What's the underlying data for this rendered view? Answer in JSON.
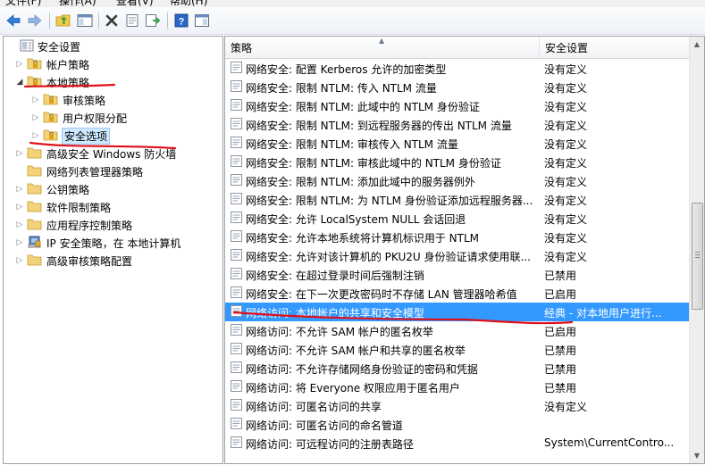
{
  "menu": {
    "items": [
      "文件(F)",
      "操作(A)",
      "查看(V)",
      "帮助(H)"
    ]
  },
  "toolbar": {
    "buttons": [
      "back-icon",
      "forward-icon",
      "up-folder-icon",
      "show-hide-tree-icon",
      "delete-icon",
      "properties-icon",
      "export-list-icon",
      "help-icon",
      "console-icon"
    ]
  },
  "tree": {
    "items": [
      {
        "label": "安全设置",
        "level": 0,
        "expanded": true
      },
      {
        "label": "帐户策略",
        "level": 1,
        "expanded": false
      },
      {
        "label": "本地策略",
        "level": 1,
        "expanded": true
      },
      {
        "label": "审核策略",
        "level": 2,
        "expanded": false
      },
      {
        "label": "用户权限分配",
        "level": 2,
        "expanded": false
      },
      {
        "label": "安全选项",
        "level": 2,
        "expanded": false,
        "selected": true
      },
      {
        "label": "高级安全 Windows 防火墙",
        "level": 1,
        "expanded": false
      },
      {
        "label": "网络列表管理器策略",
        "level": 1,
        "expanded": false
      },
      {
        "label": "公钥策略",
        "level": 1,
        "expanded": false
      },
      {
        "label": "软件限制策略",
        "level": 1,
        "expanded": false
      },
      {
        "label": "应用程序控制策略",
        "level": 1,
        "expanded": false
      },
      {
        "label": "IP 安全策略，在 本地计算机",
        "level": 1,
        "expanded": false
      },
      {
        "label": "高级审核策略配置",
        "level": 1,
        "expanded": false
      }
    ]
  },
  "list": {
    "col_policy": "策略",
    "col_setting": "安全设置",
    "rows": [
      {
        "name": "网络安全: 配置 Kerberos 允许的加密类型",
        "value": "没有定义"
      },
      {
        "name": "网络安全: 限制 NTLM: 传入 NTLM 流量",
        "value": "没有定义"
      },
      {
        "name": "网络安全: 限制 NTLM: 此域中的 NTLM 身份验证",
        "value": "没有定义"
      },
      {
        "name": "网络安全: 限制 NTLM: 到远程服务器的传出 NTLM 流量",
        "value": "没有定义"
      },
      {
        "name": "网络安全: 限制 NTLM: 审核传入 NTLM 流量",
        "value": "没有定义"
      },
      {
        "name": "网络安全: 限制 NTLM: 审核此域中的 NTLM 身份验证",
        "value": "没有定义"
      },
      {
        "name": "网络安全: 限制 NTLM: 添加此域中的服务器例外",
        "value": "没有定义"
      },
      {
        "name": "网络安全: 限制 NTLM: 为 NTLM 身份验证添加远程服务器...",
        "value": "没有定义"
      },
      {
        "name": "网络安全: 允许 LocalSystem NULL 会话回退",
        "value": "没有定义"
      },
      {
        "name": "网络安全: 允许本地系统将计算机标识用于 NTLM",
        "value": "没有定义"
      },
      {
        "name": "网络安全: 允许对该计算机的 PKU2U 身份验证请求使用联...",
        "value": "没有定义"
      },
      {
        "name": "网络安全: 在超过登录时间后强制注销",
        "value": "已禁用"
      },
      {
        "name": "网络安全: 在下一次更改密码时不存储 LAN 管理器哈希值",
        "value": "已启用"
      },
      {
        "name": "网络访问: 本地帐户的共享和安全模型",
        "value": "经典 - 对本地用户进行...",
        "selected": true
      },
      {
        "name": "网络访问: 不允许 SAM 帐户的匿名枚举",
        "value": "已启用"
      },
      {
        "name": "网络访问: 不允许 SAM 帐户和共享的匿名枚举",
        "value": "已禁用"
      },
      {
        "name": "网络访问: 不允许存储网络身份验证的密码和凭据",
        "value": "已禁用"
      },
      {
        "name": "网络访问: 将 Everyone 权限应用于匿名用户",
        "value": "已禁用"
      },
      {
        "name": "网络访问: 可匿名访问的共享",
        "value": "没有定义"
      },
      {
        "name": "网络访问: 可匿名访问的命名管道",
        "value": ""
      },
      {
        "name": "网络访问: 可远程访问的注册表路径",
        "value": "System\\CurrentContro..."
      }
    ]
  },
  "colors": {
    "selection": "#3399ff",
    "annotation_red": "#e0101a"
  }
}
